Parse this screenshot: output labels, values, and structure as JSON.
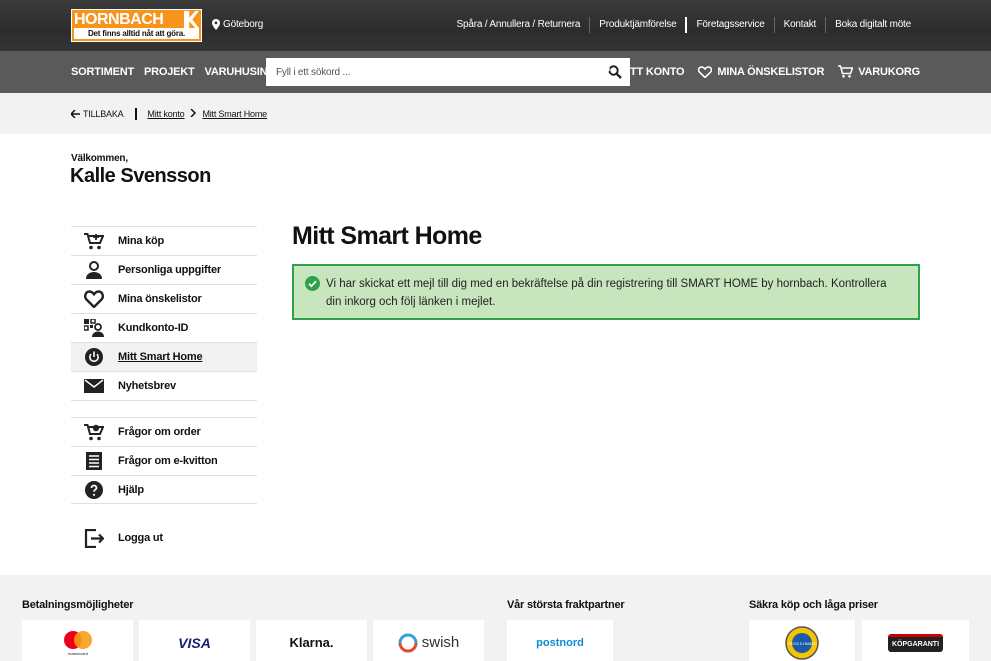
{
  "header": {
    "logo_text": "HORNBACH",
    "logo_slogan": "Det finns alltid nåt att göra.",
    "location": "Göteborg",
    "top_links": [
      "Spåra / Annullera / Returnera",
      "Produktjämförelse",
      "Företagsservice",
      "Kontakt",
      "Boka digitalt möte"
    ]
  },
  "nav": {
    "links": [
      "SORTIMENT",
      "PROJEKT",
      "VARUHUSINFO"
    ],
    "search_placeholder": "Fyll i ett sökord ...",
    "account": "MITT KONTO",
    "wishlists": "MINA ÖNSKELISTOR",
    "cart": "VARUKORG"
  },
  "breadcrumb": {
    "back": "TILLBAKA",
    "items": [
      "Mitt konto",
      "Mitt Smart Home"
    ]
  },
  "welcome": {
    "greeting": "Välkommen,",
    "name": "Kalle Svensson"
  },
  "sidebar": {
    "group1": [
      {
        "label": "Mina köp",
        "icon": "cart-icon"
      },
      {
        "label": "Personliga uppgifter",
        "icon": "person-icon"
      },
      {
        "label": "Mina önskelistor",
        "icon": "heart-icon"
      },
      {
        "label": "Kundkonto-ID",
        "icon": "qr-person-icon"
      },
      {
        "label": "Mitt Smart Home",
        "icon": "power-icon",
        "active": true
      },
      {
        "label": "Nyhetsbrev",
        "icon": "mail-icon"
      }
    ],
    "group2": [
      {
        "label": "Frågor om order",
        "icon": "cart-question-icon"
      },
      {
        "label": "Frågor om e-kvitton",
        "icon": "receipt-icon"
      },
      {
        "label": "Hjälp",
        "icon": "help-icon"
      }
    ],
    "logout": "Logga ut"
  },
  "main": {
    "title": "Mitt Smart Home",
    "alert": "Vi har skickat ett mejl till dig med en bekräftelse på din registrering till SMART HOME by hornbach. Kontrollera din inkorg och följ länken i mejlet."
  },
  "footer": {
    "payment_heading": "Betalningsmöjligheter",
    "payment_methods": [
      "mastercard",
      "VISA",
      "Klarna.",
      "swish"
    ],
    "shipping_heading": "Vår största fraktpartner",
    "shipping_partner": "postnord",
    "secure_heading": "Säkra köp och låga priser",
    "secure_badges": [
      "TRYGG E-HANDEL",
      "KÖPGARANTI"
    ]
  },
  "colors": {
    "brand_orange": "#f7941d",
    "alert_bg": "#c7e6bd",
    "alert_border": "#2ea24a"
  }
}
